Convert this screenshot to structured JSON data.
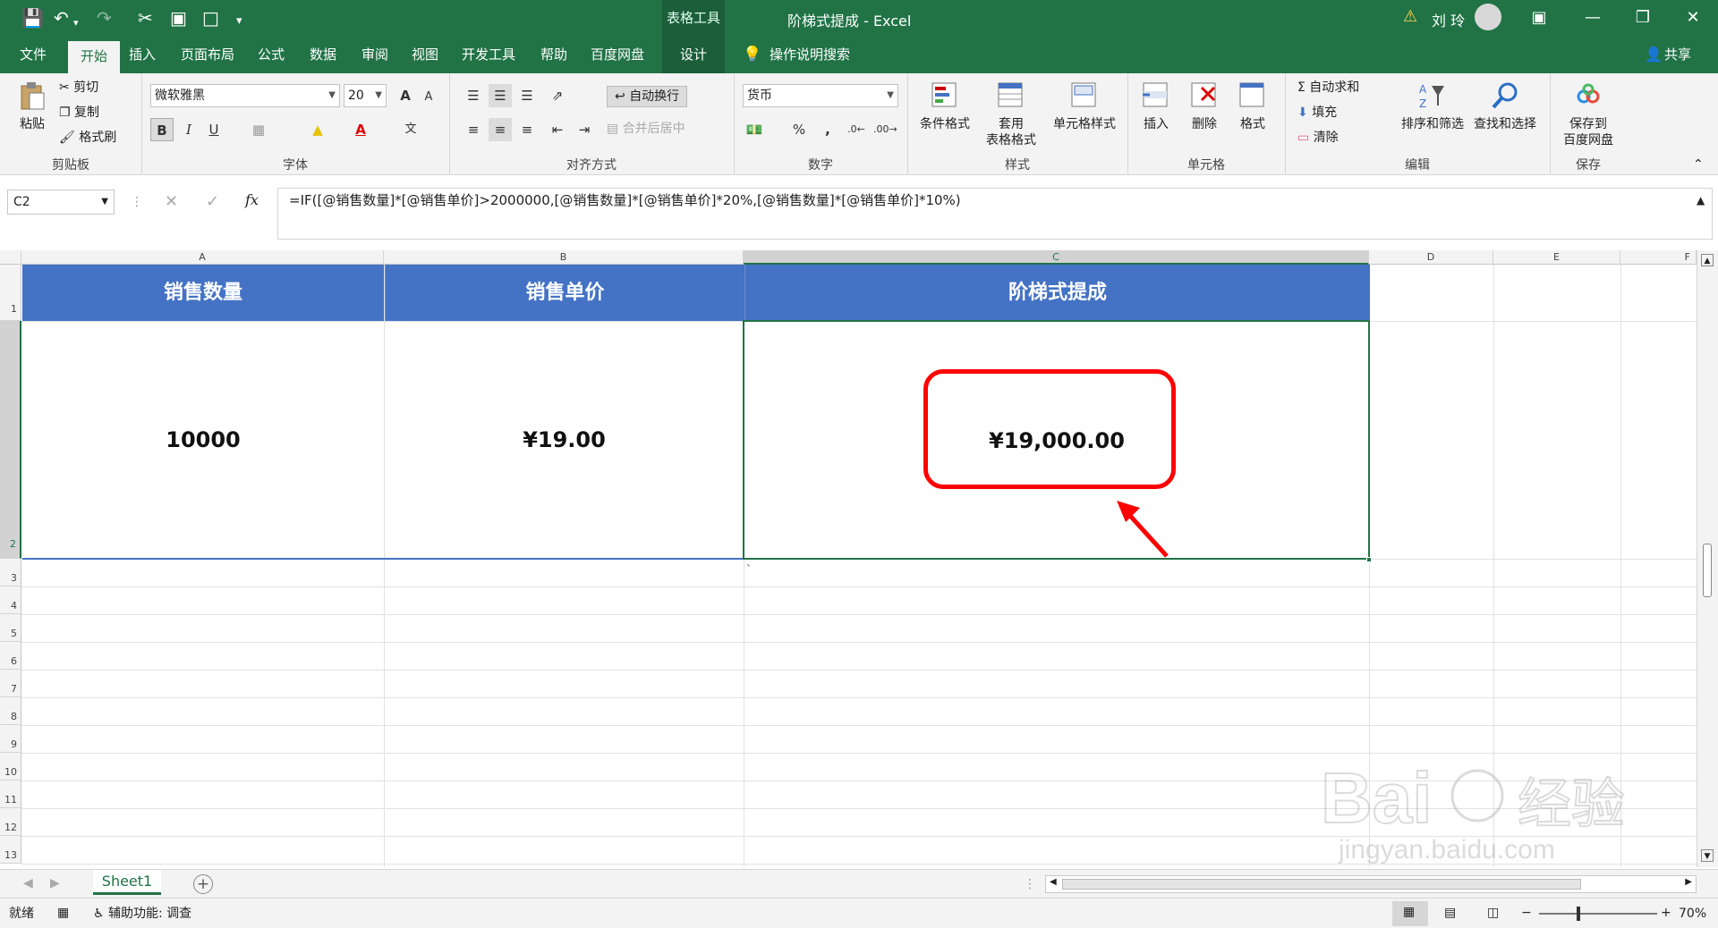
{
  "app": {
    "doc_title": "阶梯式提成  -  Excel",
    "context_tools": "表格工具",
    "user_name": "刘 玲",
    "share_label": "共享",
    "colors": {
      "excel_green": "#217346",
      "table_header": "#4472c4",
      "highlight_red": "#ff0000"
    }
  },
  "tabs": {
    "file": "文件",
    "home": "开始",
    "insert": "插入",
    "page_layout": "页面布局",
    "formulas": "公式",
    "data": "数据",
    "review": "审阅",
    "view": "视图",
    "developer": "开发工具",
    "help": "帮助",
    "baidu_pan": "百度网盘",
    "design": "设计",
    "tell_me": "操作说明搜索"
  },
  "ribbon": {
    "clipboard": {
      "paste": "粘贴",
      "cut": "剪切",
      "copy": "复制",
      "format_painter": "格式刷",
      "label": "剪贴板"
    },
    "font": {
      "name": "微软雅黑",
      "size": "20",
      "label": "字体",
      "bold": "B",
      "italic": "I",
      "underline": "U",
      "grow": "A",
      "shrink": "A"
    },
    "alignment": {
      "wrap_text": "自动换行",
      "merge_center": "合并后居中",
      "label": "对齐方式"
    },
    "number": {
      "format": "货币",
      "percent": "%",
      "comma": ",",
      "label": "数字"
    },
    "styles": {
      "conditional": "条件格式",
      "table_format_1": "套用",
      "table_format_2": "表格格式",
      "cell_styles": "单元格样式",
      "label": "样式"
    },
    "cells": {
      "insert": "插入",
      "delete": "删除",
      "format": "格式",
      "label": "单元格"
    },
    "editing": {
      "autosum": "自动求和",
      "fill": "填充",
      "clear": "清除",
      "sort_filter": "排序和筛选",
      "find_select": "查找和选择",
      "label": "编辑"
    },
    "save": {
      "save_to_1": "保存到",
      "save_to_2": "百度网盘",
      "label": "保存"
    }
  },
  "formula_bar": {
    "name_box": "C2",
    "fx": "fx",
    "formula": "=IF([@销售数量]*[@销售单价]>2000000,[@销售数量]*[@销售单价]*20%,[@销售数量]*[@销售单价]*10%)"
  },
  "grid": {
    "columns": [
      "A",
      "B",
      "C",
      "D",
      "E",
      "F"
    ],
    "rows": [
      "1",
      "2",
      "3",
      "4",
      "5",
      "6",
      "7",
      "8",
      "9",
      "10",
      "11",
      "12",
      "13"
    ],
    "headers": [
      "销售数量",
      "销售单价",
      "阶梯式提成"
    ],
    "values": [
      "10000",
      "¥19.00",
      "¥19,000.00"
    ],
    "stray_mark": "`"
  },
  "sheets": {
    "active": "Sheet1"
  },
  "status": {
    "ready": "就绪",
    "accessibility": "辅助功能: 调查",
    "zoom": "70%"
  }
}
